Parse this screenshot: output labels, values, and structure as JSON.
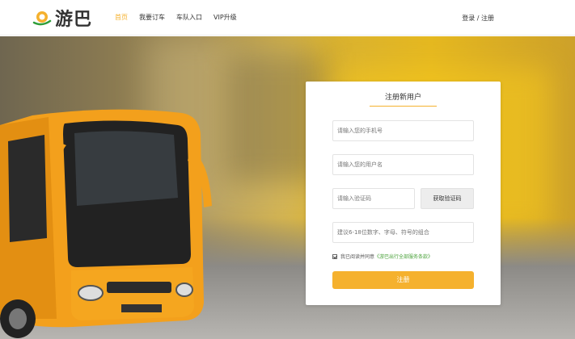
{
  "header": {
    "logo_text": "游巴",
    "nav": [
      {
        "label": "首页",
        "active": true
      },
      {
        "label": "我要订车",
        "active": false
      },
      {
        "label": "车队入口",
        "active": false
      },
      {
        "label": "VIP升级",
        "active": false
      }
    ],
    "login_label": "登录",
    "separator": " / ",
    "register_label": "注册"
  },
  "form": {
    "title": "注册新用户",
    "phone_placeholder": "请输入您的手机号",
    "username_placeholder": "请输入您的用户名",
    "code_placeholder": "请输入验证码",
    "code_button": "获取验证码",
    "password_placeholder": "建议6-18位数字、字母、符号的组合",
    "agree_text": "我已阅读并同意",
    "agree_link": "《游巴出行全部服务条款》",
    "agree_checked": true,
    "submit_label": "注册"
  },
  "colors": {
    "accent": "#f5b12e",
    "link": "#4aa23a"
  }
}
